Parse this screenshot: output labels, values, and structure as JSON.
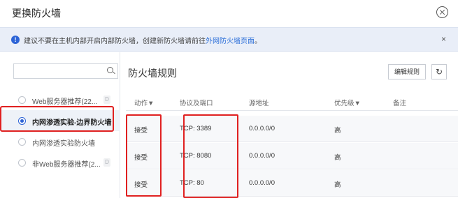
{
  "dialog": {
    "title": "更换防火墙"
  },
  "notice": {
    "text": "建议不要在主机内部开启内部防火墙，创建新防火墙请前往",
    "link": "外网防火墙页面",
    "suffix": "。",
    "close": "×"
  },
  "firewall_list": {
    "search": {
      "placeholder": "",
      "value": ""
    },
    "items": [
      {
        "label": "Web服务器推荐(22...",
        "badge": "D",
        "selected": false
      },
      {
        "label": "内网渗透实验-边界防火墙",
        "badge": "",
        "selected": true
      },
      {
        "label": "内网渗透实验防火墙",
        "badge": "",
        "selected": false
      },
      {
        "label": "非Web服务器推荐(2...",
        "badge": "D",
        "selected": false
      }
    ]
  },
  "rules": {
    "title": "防火墙规则",
    "edit_button": "编辑规则",
    "refresh_icon": "↻",
    "columns": [
      "动作▼",
      "协议及端口",
      "源地址",
      "优先级▼",
      "备注"
    ],
    "rows": [
      [
        "接受",
        "TCP: 3389",
        "0.0.0.0/0",
        "高",
        ""
      ],
      [
        "接受",
        "TCP: 8080",
        "0.0.0.0/0",
        "高",
        ""
      ],
      [
        "接受",
        "TCP: 80",
        "0.0.0.0/0",
        "高",
        ""
      ]
    ]
  },
  "colors": {
    "accent": "#2c63d6",
    "highlight": "#e02020"
  }
}
